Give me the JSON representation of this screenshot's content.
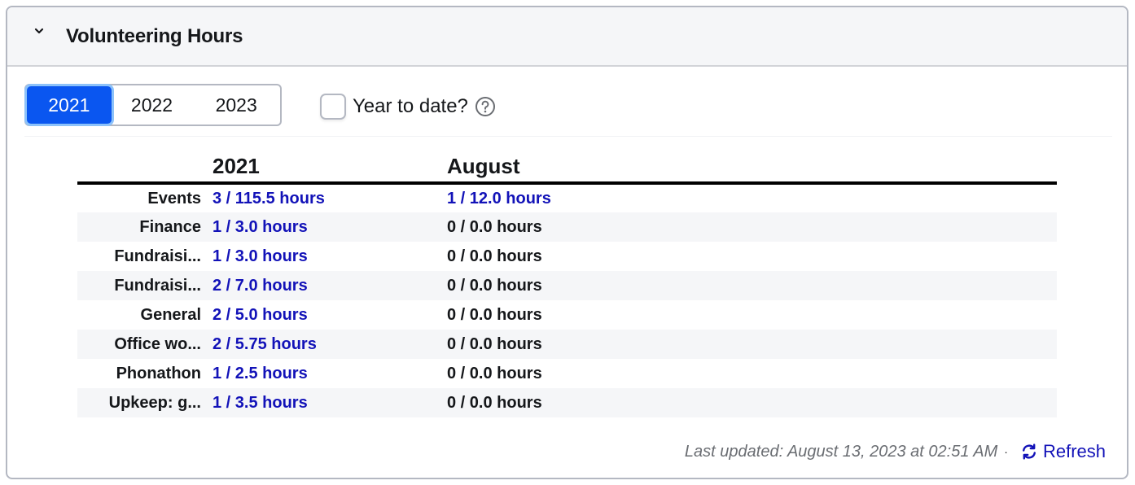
{
  "card": {
    "title": "Volunteering Hours",
    "collapse_icon": "chevron-down-icon"
  },
  "controls": {
    "years": [
      {
        "label": "2021",
        "active": true
      },
      {
        "label": "2022",
        "active": false
      },
      {
        "label": "2023",
        "active": false
      }
    ],
    "year_to_date": {
      "label": "Year to date?",
      "checked": false,
      "help_icon": "question-circle-icon"
    }
  },
  "table": {
    "headers": [
      "",
      "2021",
      "August"
    ],
    "rows": [
      {
        "label": "Events",
        "year": "3 / 115.5 hours",
        "year_link": true,
        "month": "1 / 12.0 hours",
        "month_link": true
      },
      {
        "label": "Finance",
        "year": "1 / 3.0 hours",
        "year_link": true,
        "month": "0 / 0.0 hours",
        "month_link": false
      },
      {
        "label": "Fundraisi...",
        "year": "1 / 3.0 hours",
        "year_link": true,
        "month": "0 / 0.0 hours",
        "month_link": false
      },
      {
        "label": "Fundraisi...",
        "year": "2 / 7.0 hours",
        "year_link": true,
        "month": "0 / 0.0 hours",
        "month_link": false
      },
      {
        "label": "General",
        "year": "2 / 5.0 hours",
        "year_link": true,
        "month": "0 / 0.0 hours",
        "month_link": false
      },
      {
        "label": "Office wo...",
        "year": "2 / 5.75 hours",
        "year_link": true,
        "month": "0 / 0.0 hours",
        "month_link": false
      },
      {
        "label": "Phonathon",
        "year": "1 / 2.5 hours",
        "year_link": true,
        "month": "0 / 0.0 hours",
        "month_link": false
      },
      {
        "label": "Upkeep: g...",
        "year": "1 / 3.5 hours",
        "year_link": true,
        "month": "0 / 0.0 hours",
        "month_link": false
      }
    ]
  },
  "footer": {
    "last_updated": "Last updated: August 13, 2023 at 02:51 AM",
    "separator": "·",
    "refresh_label": "Refresh",
    "refresh_icon": "refresh-icon"
  },
  "colors": {
    "accent": "#0a56f0",
    "link": "#1212b8",
    "border": "#b4b8c2",
    "header_bg": "#f5f6f8"
  }
}
